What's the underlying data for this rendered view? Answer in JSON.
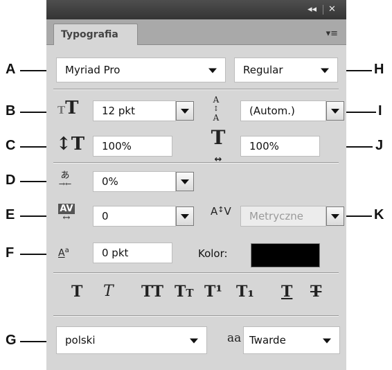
{
  "window": {
    "collapse_label": "◂◂",
    "close_label": "✕"
  },
  "panel": {
    "tab_label": "Typografia",
    "menu_label": "▾≡"
  },
  "callouts": [
    "A",
    "B",
    "C",
    "D",
    "E",
    "F",
    "G",
    "H",
    "I",
    "J",
    "K"
  ],
  "font": {
    "family": "Myriad Pro",
    "style": "Regular"
  },
  "size": {
    "value": "12 pkt"
  },
  "leading": {
    "value": "(Autom.)"
  },
  "vertical_scale": {
    "value": "100%"
  },
  "horizontal_scale": {
    "value": "100%"
  },
  "tsume": {
    "value": "0%"
  },
  "tracking": {
    "value": "0"
  },
  "kerning": {
    "value": "Metryczne",
    "disabled": true
  },
  "baseline_shift": {
    "value": "0 pkt"
  },
  "color": {
    "label": "Kolor:",
    "swatch": "#000000"
  },
  "format_buttons": [
    {
      "name": "bold",
      "glyph": "T"
    },
    {
      "name": "italic",
      "glyph": "T"
    },
    {
      "name": "all-caps",
      "glyph": "TT"
    },
    {
      "name": "small-caps",
      "glyph": "TT"
    },
    {
      "name": "superscript",
      "glyph": "T¹"
    },
    {
      "name": "subscript",
      "glyph": "T₁"
    },
    {
      "name": "underline",
      "glyph": "T"
    },
    {
      "name": "strikethrough",
      "glyph": "T"
    }
  ],
  "language": {
    "value": "polski"
  },
  "antialias": {
    "icon": "aa",
    "value": "Twarde"
  }
}
